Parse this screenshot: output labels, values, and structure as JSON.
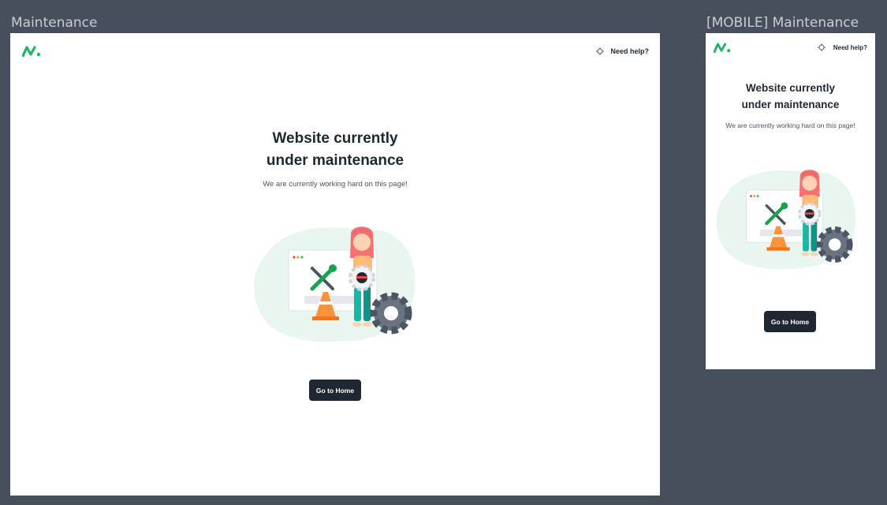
{
  "desktop": {
    "frame_label": "Maintenance",
    "help_label": "Need help?",
    "title_line1": "Website currently",
    "title_line2": "under maintenance",
    "subtitle": "We are currently working hard on this page!",
    "button_label": "Go to Home"
  },
  "mobile": {
    "frame_label": "[MOBILE] Maintenance",
    "help_label": "Need help?",
    "title_line1": "Website currently",
    "title_line2": "under maintenance",
    "subtitle": "We are currently working hard on this page!",
    "button_label": "Go to Home"
  },
  "colors": {
    "canvas": "#464f5b",
    "brand": "#1fb46c",
    "button": "#1f2730",
    "illustration_bg": "#e8f6ef"
  },
  "icons": [
    "logo-icon",
    "help-icon",
    "tools-icon",
    "gear-icon",
    "traffic-cone-icon"
  ]
}
